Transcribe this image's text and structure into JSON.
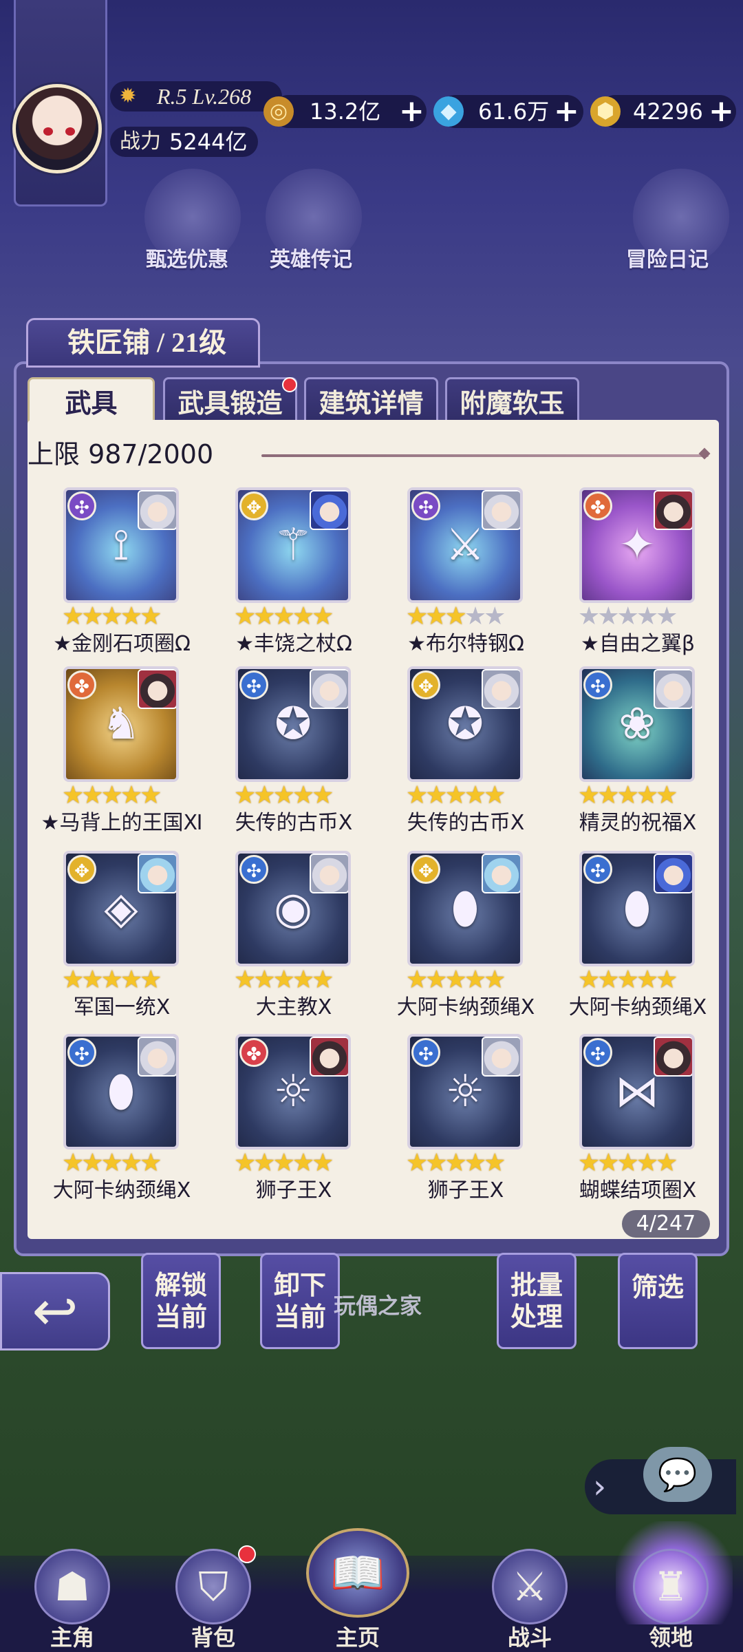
{
  "player": {
    "rank_level": "R.5 Lv.268",
    "power_label": "战力",
    "power_value": "5244亿"
  },
  "resources": [
    {
      "icon": "gold-coin-icon",
      "value": "13.2亿"
    },
    {
      "icon": "crystal-icon",
      "value": "61.6万"
    },
    {
      "icon": "gold-gem-icon",
      "value": "42296"
    }
  ],
  "shortcuts": [
    "甄选优惠",
    "英雄传记",
    "冒险日记"
  ],
  "panel": {
    "title": "铁匠铺 / 21级",
    "tabs": [
      {
        "label": "武具",
        "active": true
      },
      {
        "label": "武具锻造",
        "active": false,
        "badge": true
      },
      {
        "label": "建筑详情",
        "active": false
      },
      {
        "label": "附魔软玉",
        "active": false
      }
    ],
    "capacity": "上限 987/2000",
    "page_count": "4/247"
  },
  "items": [
    {
      "name": "★金刚石项圈Ω",
      "stars": 5,
      "card": "blue",
      "element": "violet",
      "hero": "light",
      "glyph": "⟟"
    },
    {
      "name": "★丰饶之杖Ω",
      "stars": 5,
      "card": "blue",
      "element": "yellow",
      "hero": "blue",
      "glyph": "⚚"
    },
    {
      "name": "★布尔特钢Ω",
      "stars": 3,
      "card": "blue",
      "element": "violet",
      "hero": "light",
      "glyph": "⚔"
    },
    {
      "name": "★自由之翼β",
      "stars": 0,
      "card": "purple",
      "element": "orange",
      "hero": "dark",
      "glyph": "✦"
    },
    {
      "name": "★马背上的王国Ⅺ",
      "stars": 5,
      "card": "gold",
      "element": "orange",
      "hero": "dark",
      "glyph": "♞"
    },
    {
      "name": "失传的古币Ⅹ",
      "stars": 5,
      "card": "dark",
      "element": "blue",
      "hero": "light",
      "glyph": "✪"
    },
    {
      "name": "失传的古币Ⅹ",
      "stars": 5,
      "card": "dark",
      "element": "yellow",
      "hero": "light",
      "glyph": "✪"
    },
    {
      "name": "精灵的祝福Ⅹ",
      "stars": 5,
      "card": "teal",
      "element": "blue",
      "hero": "light",
      "glyph": "❀"
    },
    {
      "name": "军国一统Ⅹ",
      "stars": 5,
      "card": "dark",
      "element": "yellow",
      "hero": "ice",
      "glyph": "◈"
    },
    {
      "name": "大主教Ⅹ",
      "stars": 5,
      "card": "dark",
      "element": "blue",
      "hero": "light",
      "glyph": "◉"
    },
    {
      "name": "大阿卡纳颈绳Ⅹ",
      "stars": 5,
      "card": "dark",
      "element": "yellow",
      "hero": "ice",
      "glyph": "⬮"
    },
    {
      "name": "大阿卡纳颈绳Ⅹ",
      "stars": 5,
      "card": "dark",
      "element": "blue",
      "hero": "blue",
      "glyph": "⬮"
    },
    {
      "name": "大阿卡纳颈绳Ⅹ",
      "stars": 5,
      "card": "dark",
      "element": "blue",
      "hero": "light",
      "glyph": "⬮"
    },
    {
      "name": "狮子王Ⅹ",
      "stars": 5,
      "card": "dark",
      "element": "red",
      "hero": "dark",
      "glyph": "☼"
    },
    {
      "name": "狮子王Ⅹ",
      "stars": 5,
      "card": "dark",
      "element": "blue",
      "hero": "light",
      "glyph": "☼"
    },
    {
      "name": "蝴蝶结项圈Ⅹ",
      "stars": 5,
      "card": "dark",
      "element": "blue",
      "hero": "dark",
      "glyph": "⋈"
    }
  ],
  "actions": [
    {
      "label1": "解锁",
      "label2": "当前"
    },
    {
      "label1": "卸下",
      "label2": "当前"
    },
    {
      "label1": "批量",
      "label2": "处理"
    },
    {
      "label1": "筛选",
      "label2": ""
    }
  ],
  "building_label": "玩偶之家",
  "nav": [
    {
      "label": "主角"
    },
    {
      "label": "背包",
      "badge": true
    },
    {
      "label": "主页"
    },
    {
      "label": "战斗"
    },
    {
      "label": "领地",
      "active": true
    }
  ]
}
